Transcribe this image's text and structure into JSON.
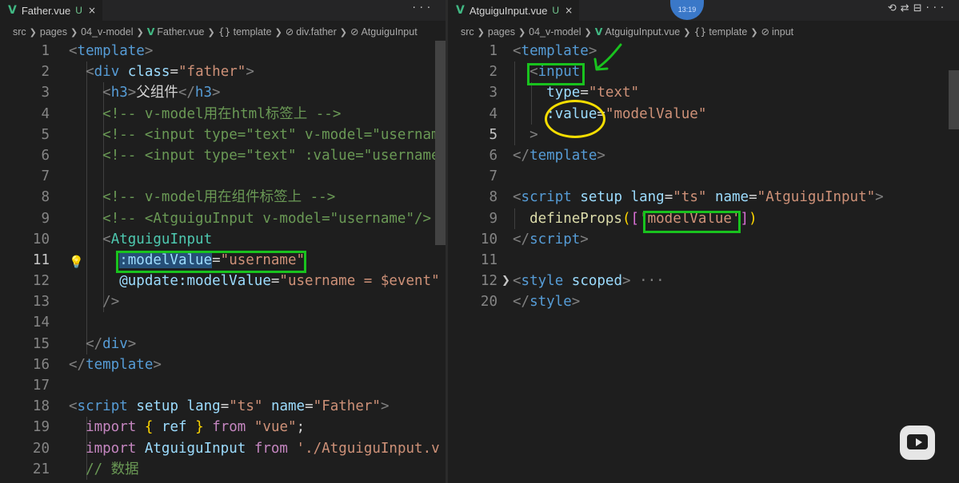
{
  "left_editor": {
    "tab": {
      "filename": "Father.vue",
      "status": "U",
      "close": "×",
      "more": "···"
    },
    "breadcrumb": [
      "src",
      "pages",
      "04_v-model",
      "Father.vue",
      "template",
      "div.father",
      "AtguiguInput"
    ],
    "breadcrumb_icons": {
      "template": "{}",
      "div_father": "⊘",
      "atguigu_input": "⊘"
    },
    "lines": [
      {
        "n": "1",
        "segs": [
          [
            "t-punc",
            "<"
          ],
          [
            "t-tag",
            "template"
          ],
          [
            "t-punc",
            ">"
          ]
        ]
      },
      {
        "n": "2",
        "segs": [
          [
            "",
            "  "
          ],
          [
            "t-punc",
            "<"
          ],
          [
            "t-tag",
            "div"
          ],
          [
            "",
            " "
          ],
          [
            "t-attr",
            "class"
          ],
          [
            "",
            "="
          ],
          [
            "t-str",
            "\"father\""
          ],
          [
            "t-punc",
            ">"
          ]
        ]
      },
      {
        "n": "3",
        "segs": [
          [
            "",
            "    "
          ],
          [
            "t-punc",
            "<"
          ],
          [
            "t-tag",
            "h3"
          ],
          [
            "t-punc",
            ">"
          ],
          [
            "",
            "父组件"
          ],
          [
            "t-punc",
            "</"
          ],
          [
            "t-tag",
            "h3"
          ],
          [
            "t-punc",
            ">"
          ]
        ]
      },
      {
        "n": "4",
        "segs": [
          [
            "",
            "    "
          ],
          [
            "t-com",
            "<!-- v-model用在html标签上 -->"
          ]
        ]
      },
      {
        "n": "5",
        "segs": [
          [
            "",
            "    "
          ],
          [
            "t-com",
            "<!-- <input type=\"text\" v-model=\"usernam"
          ]
        ]
      },
      {
        "n": "6",
        "segs": [
          [
            "",
            "    "
          ],
          [
            "t-com",
            "<!-- <input type=\"text\" :value=\"username"
          ]
        ]
      },
      {
        "n": "7",
        "segs": []
      },
      {
        "n": "8",
        "segs": [
          [
            "",
            "    "
          ],
          [
            "t-com",
            "<!-- v-model用在组件标签上 -->"
          ]
        ]
      },
      {
        "n": "9",
        "segs": [
          [
            "",
            "    "
          ],
          [
            "t-com",
            "<!-- <AtguiguInput v-model=\"username\"/>"
          ]
        ]
      },
      {
        "n": "10",
        "segs": [
          [
            "",
            "    "
          ],
          [
            "t-punc",
            "<"
          ],
          [
            "t-comp",
            "AtguiguInput"
          ]
        ]
      },
      {
        "n": "11",
        "segs": [
          [
            "",
            "      "
          ],
          [
            "t-attr sel",
            ":modelValue"
          ],
          [
            "",
            "="
          ],
          [
            "t-str",
            "\"username\""
          ]
        ]
      },
      {
        "n": "12",
        "segs": [
          [
            "",
            "      "
          ],
          [
            "t-attr",
            "@update:modelValue"
          ],
          [
            "",
            "="
          ],
          [
            "t-str",
            "\"username = $event\""
          ]
        ]
      },
      {
        "n": "13",
        "segs": [
          [
            "",
            "    "
          ],
          [
            "t-punc",
            "/>"
          ]
        ]
      },
      {
        "n": "14",
        "segs": []
      },
      {
        "n": "15",
        "segs": [
          [
            "",
            "  "
          ],
          [
            "t-punc",
            "</"
          ],
          [
            "t-tag",
            "div"
          ],
          [
            "t-punc",
            ">"
          ]
        ]
      },
      {
        "n": "16",
        "segs": [
          [
            "t-punc",
            "</"
          ],
          [
            "t-tag",
            "template"
          ],
          [
            "t-punc",
            ">"
          ]
        ]
      },
      {
        "n": "17",
        "segs": []
      },
      {
        "n": "18",
        "segs": [
          [
            "t-punc",
            "<"
          ],
          [
            "t-tag",
            "script"
          ],
          [
            "",
            " "
          ],
          [
            "t-attr",
            "setup"
          ],
          [
            "",
            " "
          ],
          [
            "t-attr",
            "lang"
          ],
          [
            "",
            "="
          ],
          [
            "t-str",
            "\"ts\""
          ],
          [
            "",
            " "
          ],
          [
            "t-attr",
            "name"
          ],
          [
            "",
            "="
          ],
          [
            "t-str",
            "\"Father\""
          ],
          [
            "t-punc",
            ">"
          ]
        ]
      },
      {
        "n": "19",
        "segs": [
          [
            "",
            "  "
          ],
          [
            "t-kw",
            "import"
          ],
          [
            "",
            " "
          ],
          [
            "t-brk",
            "{"
          ],
          [
            "",
            " "
          ],
          [
            "t-attr",
            "ref"
          ],
          [
            "",
            " "
          ],
          [
            "t-brk",
            "}"
          ],
          [
            "",
            " "
          ],
          [
            "t-kw",
            "from"
          ],
          [
            "",
            " "
          ],
          [
            "t-str",
            "\"vue\""
          ],
          [
            "",
            ";"
          ]
        ]
      },
      {
        "n": "20",
        "segs": [
          [
            "",
            "  "
          ],
          [
            "t-kw",
            "import"
          ],
          [
            "",
            " "
          ],
          [
            "t-attr",
            "AtguiguInput"
          ],
          [
            "",
            " "
          ],
          [
            "t-kw",
            "from"
          ],
          [
            "",
            " "
          ],
          [
            "t-str",
            "'./AtguiguInput.v"
          ]
        ]
      },
      {
        "n": "21",
        "segs": [
          [
            "",
            "  "
          ],
          [
            "t-com",
            "// 数据"
          ]
        ]
      }
    ]
  },
  "right_editor": {
    "tab": {
      "filename": "AtguiguInput.vue",
      "status": "U",
      "close": "×"
    },
    "actions": [
      "⟲",
      "⇄",
      "⊟",
      "···"
    ],
    "overlay_time": "13:19",
    "breadcrumb": [
      "src",
      "pages",
      "04_v-model",
      "AtguiguInput.vue",
      "template",
      "input"
    ],
    "breadcrumb_icons": {
      "template": "{}",
      "input": "⊘"
    },
    "lines": [
      {
        "n": "1",
        "segs": [
          [
            "t-punc",
            "<"
          ],
          [
            "t-tag",
            "template"
          ],
          [
            "t-punc",
            ">"
          ]
        ]
      },
      {
        "n": "2",
        "segs": [
          [
            "",
            "  "
          ],
          [
            "t-punc",
            "<"
          ],
          [
            "t-tag",
            "input"
          ]
        ]
      },
      {
        "n": "3",
        "segs": [
          [
            "",
            "    "
          ],
          [
            "t-attr",
            "type"
          ],
          [
            "",
            "="
          ],
          [
            "t-str",
            "\"text\""
          ]
        ]
      },
      {
        "n": "4",
        "segs": [
          [
            "",
            "    "
          ],
          [
            "t-attr",
            ":value"
          ],
          [
            "",
            "="
          ],
          [
            "t-str",
            "\"modelValue\""
          ]
        ]
      },
      {
        "n": "5",
        "segs": [
          [
            "",
            "  "
          ],
          [
            "t-punc",
            ">"
          ]
        ]
      },
      {
        "n": "6",
        "segs": [
          [
            "t-punc",
            "</"
          ],
          [
            "t-tag",
            "template"
          ],
          [
            "t-punc",
            ">"
          ]
        ]
      },
      {
        "n": "7",
        "segs": []
      },
      {
        "n": "8",
        "segs": [
          [
            "t-punc",
            "<"
          ],
          [
            "t-tag",
            "script"
          ],
          [
            "",
            " "
          ],
          [
            "t-attr",
            "setup"
          ],
          [
            "",
            " "
          ],
          [
            "t-attr",
            "lang"
          ],
          [
            "",
            "="
          ],
          [
            "t-str",
            "\"ts\""
          ],
          [
            "",
            " "
          ],
          [
            "t-attr",
            "name"
          ],
          [
            "",
            "="
          ],
          [
            "t-str",
            "\"AtguiguInput\""
          ],
          [
            "t-punc",
            ">"
          ]
        ]
      },
      {
        "n": "9",
        "segs": [
          [
            "",
            "  "
          ],
          [
            "t-fn",
            "defineProps"
          ],
          [
            "t-brk",
            "("
          ],
          [
            "t-brk2",
            "["
          ],
          [
            "t-str",
            "'modelValue'"
          ],
          [
            "t-brk2",
            "]"
          ],
          [
            "t-brk",
            ")"
          ]
        ]
      },
      {
        "n": "10",
        "segs": [
          [
            "t-punc",
            "</"
          ],
          [
            "t-tag",
            "script"
          ],
          [
            "t-punc",
            ">"
          ]
        ]
      },
      {
        "n": "11",
        "segs": []
      },
      {
        "n": "12",
        "segs": [
          [
            "t-punc",
            "<"
          ],
          [
            "t-tag",
            "style"
          ],
          [
            "",
            " "
          ],
          [
            "t-attr",
            "scoped"
          ],
          [
            "t-punc",
            ">"
          ],
          [
            "t-punc",
            " ···"
          ]
        ]
      },
      {
        "n": "20",
        "segs": [
          [
            "t-punc",
            "</"
          ],
          [
            "t-tag",
            "style"
          ],
          [
            "t-punc",
            ">"
          ]
        ]
      }
    ]
  }
}
